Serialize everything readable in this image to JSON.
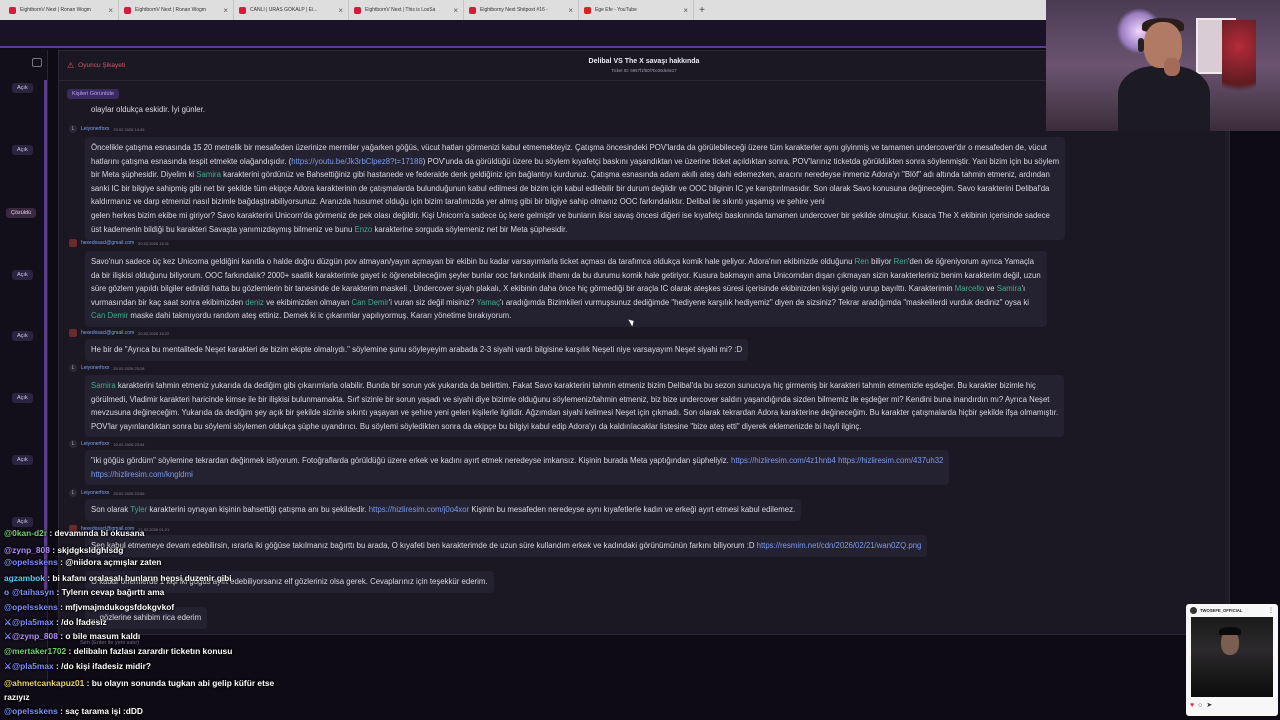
{
  "browser": {
    "tabs": [
      {
        "label": "EightbornV Next | Ronan Wogm",
        "icon": "red-logo-icon"
      },
      {
        "label": "EightbornV Next | Ronan Wogm",
        "icon": "red-logo-icon"
      },
      {
        "label": "CANLI | URAS GÖKALP | Ei...",
        "icon": "red-logo-icon"
      },
      {
        "label": "EightbornV Next | This is LosSa",
        "icon": "red-logo-icon"
      },
      {
        "label": "Eightborny Next Shitpost #16 -",
        "icon": "red-logo-icon"
      },
      {
        "label": "Ege Efe - YouTube",
        "icon": "youtube-icon"
      }
    ],
    "new_tab": "+"
  },
  "sidebar": {
    "badges": [
      "Açık",
      "Açık",
      "Çözüldü",
      "Açık",
      "Açık",
      "Açık",
      "Açık",
      "Açık"
    ]
  },
  "panel": {
    "complaint_label": "Oyuncu Şikayeti",
    "ticket_title": "Delibal VS The X savaşı hakkında",
    "ticket_id": "Ticket ID: 6997f1f60f7bc00de8e27",
    "view_people": "Kişileri Görüntüle",
    "input_placeholder": "Sen (Enter ile yeni satır)",
    "top_fragment": "olaylar oldukça eskidir. İyi günler."
  },
  "messages": [
    {
      "author": "Leiyonerfoxx",
      "date": "20.02.2026 14:45",
      "avatar": "L",
      "lines": [
        [
          {
            "t": "Öncelikle çatışma esnasında 15 20 metrelik bir mesafeden üzerinize mermiler yağarken göğüs, vücut hatları görmenizi kabul etmemekteyiz. Çatışma öncesindeki POV'larda da görülebileceği üzere tüm karakterler aynı giyinmiş ve tamamen undercover'dır o mesafeden de, vücut"
          }
        ],
        [
          {
            "t": "hatlarını çatışma esnasında tespit etmekte olağandışıdır. ("
          },
          {
            "t": "https://youtu.be/Jk3rbClpez8?t=17188",
            "c": "link"
          },
          {
            "t": ") POV'unda da görüldüğü üzere bu söylem kıyafetçi baskını yaşandıktan ve üzerine ticket açıldıktan sonra, POV'larınız ticketda görüldükten sonra söylenmiştir. Yani bizim için bu söylem"
          }
        ],
        [
          {
            "t": "bir Meta şüphesidir. Diyelim ki "
          },
          {
            "t": "Samira",
            "c": "mention"
          },
          {
            "t": " karakterini gördünüz ve Bahsettiğiniz gibi hastanede ve federalde denk geldiğiniz için bağlantıyı kurdunuz. Çatışma esnasında adam akıllı ateş dahi edemezken, aracını neredeyse inmeniz Adora'yı \"Blöf\" adı altında tahmin etmeniz, ardından"
          }
        ],
        [
          {
            "t": "sanki IC bir bilgiye sahipmiş gibi net bir şekilde tüm ekipçe Adora karakterinin de çatışmalarda bulunduğunun kabul edilmesi de bizim için kabul edilebilir bir durum değildir ve OOC bilginin IC ye karıştırılmasıdır. Son olarak Savo konusuna değineceğim. Savo karakterini Delibal'da"
          }
        ],
        [
          {
            "t": "kaldırmanız ve darp etmenizi nasıl bizimle bağdaştırabiliyorsunuz. Aranızda husumet olduğu için bizim tarafımızda yer almış gibi bir bilgiye sahip olmanız OOC farkındalıktır. Delibal ile sıkıntı yaşamış ve şehire yeni"
          }
        ],
        [
          {
            "t": "gelen herkes bizim ekibe mi giriyor? Savo karakterini Unicorn'da görmeniz de pek olası değildir. Kişi Unicorn'a sadece üç kere gelmiştir ve bunların ikisi savaş öncesi diğeri ise kıyafetçi baskınında tamamen undercover bir şekilde olmuştur. Kısaca The X ekibinin içerisinde sadece"
          }
        ],
        [
          {
            "t": "üst kademenin bildiği bu karakteri Savaşta yanımızdaymış bilmeniz ve bunu "
          },
          {
            "t": "Enzo",
            "c": "mention"
          },
          {
            "t": " karakterine sorguda söylemeniz net bir Meta şüphesidir."
          }
        ]
      ]
    },
    {
      "author": "hexedosacl@gmail.com",
      "date": "20.02.2026 15:11",
      "avatar": "img",
      "lines": [
        [
          {
            "t": "Savo'nun sadece üç kez Unicorna geldiğini kanıtla o halde doğru düzgün pov atmayan/yayın açmayan bir ekibin bu kadar varsayımlarla ticket açması da tarafımca oldukça komik hale geliyor. Adora'nın ekibinizde olduğunu "
          },
          {
            "t": "Ren",
            "c": "mention"
          },
          {
            "t": " biliyor "
          },
          {
            "t": "Ren",
            "c": "mention"
          },
          {
            "t": "'den de öğreniyorum ayrıca Yamaçla"
          }
        ],
        [
          {
            "t": "da bir ilişkisi olduğunu biliyorum. OOC farkındalık? 2000+ saatlik karakterimle gayet ic öğrenebileceğim şeyler bunlar ooc farkındalık ithamı da bu durumu komik hale getiriyor. Kusura bakmayın ama Unicorndan dışarı çıkmayan sizin karakterleriniz benim karakterim değil, uzun"
          }
        ],
        [
          {
            "t": "süre gözlem yapıldı bilgiler edinildi hatta bu gözlemlerin bir tanesinde de karakterim maskeli , Undercover siyah plakalı, X ekibinin daha önce hiç görmediği bir araçla IC olarak ateşkes süresi içerisinde ekibinizden kişiyi gelip vurup bayılttı. Karakterimin "
          },
          {
            "t": "Marcello",
            "c": "mention"
          },
          {
            "t": " ve "
          },
          {
            "t": "Samira",
            "c": "mention"
          },
          {
            "t": "'ı"
          }
        ],
        [
          {
            "t": "vurmasından bir kaç saat sonra ekibimizden "
          },
          {
            "t": "deniz",
            "c": "mention"
          },
          {
            "t": " ve ekibimizden olmayan "
          },
          {
            "t": "Can Demir",
            "c": "mention"
          },
          {
            "t": "'i vuran siz değil misiniz? "
          },
          {
            "t": "Yamaç",
            "c": "mention"
          },
          {
            "t": "'ı aradığımda Bizimkileri vurmuşsunuz dediğimde \"hediyene karşılık hediyemiz\" diyen de sizsiniz? Tekrar aradığımda \"maskelilerdi vurduk dediniz\" oysa ki"
          }
        ],
        [
          {
            "t": "Can Demir",
            "c": "mention"
          },
          {
            "t": " maske dahi takmıyordu random ateş ettiniz. Demek ki ic çıkarımlar yapılıyormuş. Kararı yönetime bırakıyorum."
          }
        ]
      ]
    },
    {
      "author": "hexedosacl@gmail.com",
      "date": "20.02.2026 15:22",
      "avatar": "img",
      "lines": [
        [
          {
            "t": "He bir de \"Ayrıca bu mentalitede Neşet karakteri de bizim ekipte olmalıydı.\" söylemine şunu söyleyeyim arabada 2-3 siyahi vardı bilgisine karşılık Neşeti niye varsayayım Neşet siyahi mi? :D"
          }
        ]
      ]
    },
    {
      "author": "Leiyonerfoxx",
      "date": "20.02.2026 23:28",
      "avatar": "L",
      "lines": [
        [
          {
            "t": "Samira",
            "c": "mention"
          },
          {
            "t": " karakterini tahmin etmeniz yukarıda da dediğim gibi çıkarımlarla olabilir. Bunda bir sorun yok yukarıda da belirttim. Fakat Savo karakterini tahmin etmeniz bizim Delibal'da bu sezon sunucuya hiç girmemiş bir karakteri tahmin etmemizle eşdeğer. Bu karakter bizimle hiç"
          }
        ],
        [
          {
            "t": "görülmedi, Vladimir karakteri haricinde kimse ile bir ilişkisi bulunmamakta. Sırf sizinle bir sorun yaşadı ve siyahi diye bizimle olduğunu söylemeniz/tahmin etmeniz, biz bize undercover saldırı yaşandığında sizden bilmemiz ile eşdeğer mi? Kendini buna inandırdın mı? Ayrıca Neşet"
          }
        ],
        [
          {
            "t": "mevzusuna değineceğim. Yukarıda da dediğim şey açık bir şekilde sizinle sıkıntı yaşayan ve şehire yeni gelen kişilerle ilgilidir. Ağzımdan siyahi kelimesi Neşet için çıkmadı. Son olarak tekrardan Adora karakterine değineceğim. Bu karakter çatışmalarda hiçbir şekilde ifşa olmamıştır."
          }
        ],
        [
          {
            "t": "POV'lar yayınlandıktan sonra bu söylemi söylemen oldukça şüphe uyandırıcı. Bu söylemi söyledikten sonra da ekipçe bu bilgiyi kabul edip Adora'yı da kaldırılacaklar listesine \"bize ateş etti\" diyerek eklemenizde bi hayli ilginç."
          }
        ]
      ]
    },
    {
      "author": "Leiyonerfoxx",
      "date": "20.02.2026 23:54",
      "avatar": "L",
      "lines": [
        [
          {
            "t": "\"iki göğüs gördüm\" söylemine tekrardan değinmek istiyorum. Fotoğraflarda görüldüğü üzere erkek ve kadını ayırt etmek neredeyse imkansız. Kişinin burada Meta yaptığından şüpheliyiz. "
          },
          {
            "t": "https://hizliresim.com/4z1hnb4",
            "c": "link"
          },
          {
            "t": "  "
          },
          {
            "t": "https://hizliresim.com/437uh32",
            "c": "link"
          }
        ],
        [
          {
            "t": "https://hizliresim.com/kngldmi",
            "c": "link"
          }
        ]
      ]
    },
    {
      "author": "Leiyonerfoxx",
      "date": "20.02.2026 23:56",
      "avatar": "L",
      "lines": [
        [
          {
            "t": "Son olarak "
          },
          {
            "t": "Tyler",
            "c": "mention"
          },
          {
            "t": " karakterini oynayan kişinin bahsettiği çatışma anı bu şekildedir. "
          },
          {
            "t": "https://hizliresim.com/j0o4xor",
            "c": "link"
          },
          {
            "t": " Kişinin bu mesafeden neredeyse aynı kıyafetlerle kadın ve erkeği  ayırt etmesi kabul edilemez."
          }
        ]
      ]
    },
    {
      "author": "hexedosacl@gmail.com",
      "date": "21.02.2026 01:21",
      "avatar": "img",
      "lines": [
        [
          {
            "t": "Sen kabul etmemeye devam edebilirsin, ısrarla iki göğüse takılmanız bağırttı bu arada, O kıyafeti ben karakterimde de uzun süre kullandım erkek ve kadındaki görünümünün farkını biliyorum :D "
          },
          {
            "t": "https://resmim.net/cdn/2026/02/21/wan0ZQ.png",
            "c": "link"
          }
        ]
      ]
    },
    {
      "author": "",
      "date": "",
      "avatar": "",
      "lines": [
        [
          {
            "t": "O kadar önemlerde 1 kişi iki göğüs ayırt edebiliyorsanız elf gözleriniz olsa gerek. Cevaplarınız için teşekkür ederim."
          }
        ]
      ]
    },
    {
      "author": "",
      "date": "",
      "avatar": "",
      "lines": [
        [
          {
            "t": "... gözlerine sahibim rica ederim"
          }
        ]
      ]
    }
  ],
  "chat": [
    {
      "user": "@0kan-d2r",
      "text": " : devamında bi okusana",
      "color": "u-green",
      "icon": ""
    },
    {
      "user": "@zynp_808",
      "text": " : skjdgksldghlsdg",
      "color": "u-purple",
      "icon": ""
    },
    {
      "user": "@opelsskens",
      "text": " : @niidora açmışlar zaten",
      "color": "u-blue",
      "icon": ""
    },
    {
      "user": "agzambok",
      "text": " : bi kafanı oralaşalı bunların hepsi duzenir gibi",
      "color": "u-cyan",
      "icon": ""
    },
    {
      "user": "@taihasyn",
      "text": " : Tylerın cevap bağırttı ama",
      "color": "u-blue",
      "icon": "o"
    },
    {
      "user": "@opelsskens",
      "text": " : mfjvmajmdukogsfdokgvkof",
      "color": "u-blue",
      "icon": ""
    },
    {
      "user": "@pla5max",
      "text": " : /do İfadesiz",
      "color": "u-blue",
      "icon": "⚔"
    },
    {
      "user": "@zynp_808",
      "text": " : o bile masum kaldı",
      "color": "u-purple",
      "icon": "⚔"
    },
    {
      "user": "@mertaker1702",
      "text": " : delibalın fazlası zarardır ticketın konusu",
      "color": "u-green",
      "icon": ""
    },
    {
      "user": "@pla5max",
      "text": " : /do kişi ifadesiz midir?",
      "color": "u-blue",
      "icon": "⚔"
    },
    {
      "user": "@ahmetcankapuz01",
      "text": " : bu olayın sonunda tugkan abi gelip küfür etse",
      "color": "u-yellow",
      "icon": ""
    },
    {
      "user": "razıyız",
      "text": "",
      "color": "u-white",
      "icon": ""
    },
    {
      "user": "@opelsskens",
      "text": " : saç tarama işi :dDD",
      "color": "u-blue",
      "icon": ""
    }
  ],
  "instagram": {
    "name": "TWOSEFE_OFFICIAL",
    "more": "⋮"
  },
  "colors": {
    "accent": "#5c3a9a",
    "mention": "#3fae8a",
    "link": "#7c9cf0"
  }
}
